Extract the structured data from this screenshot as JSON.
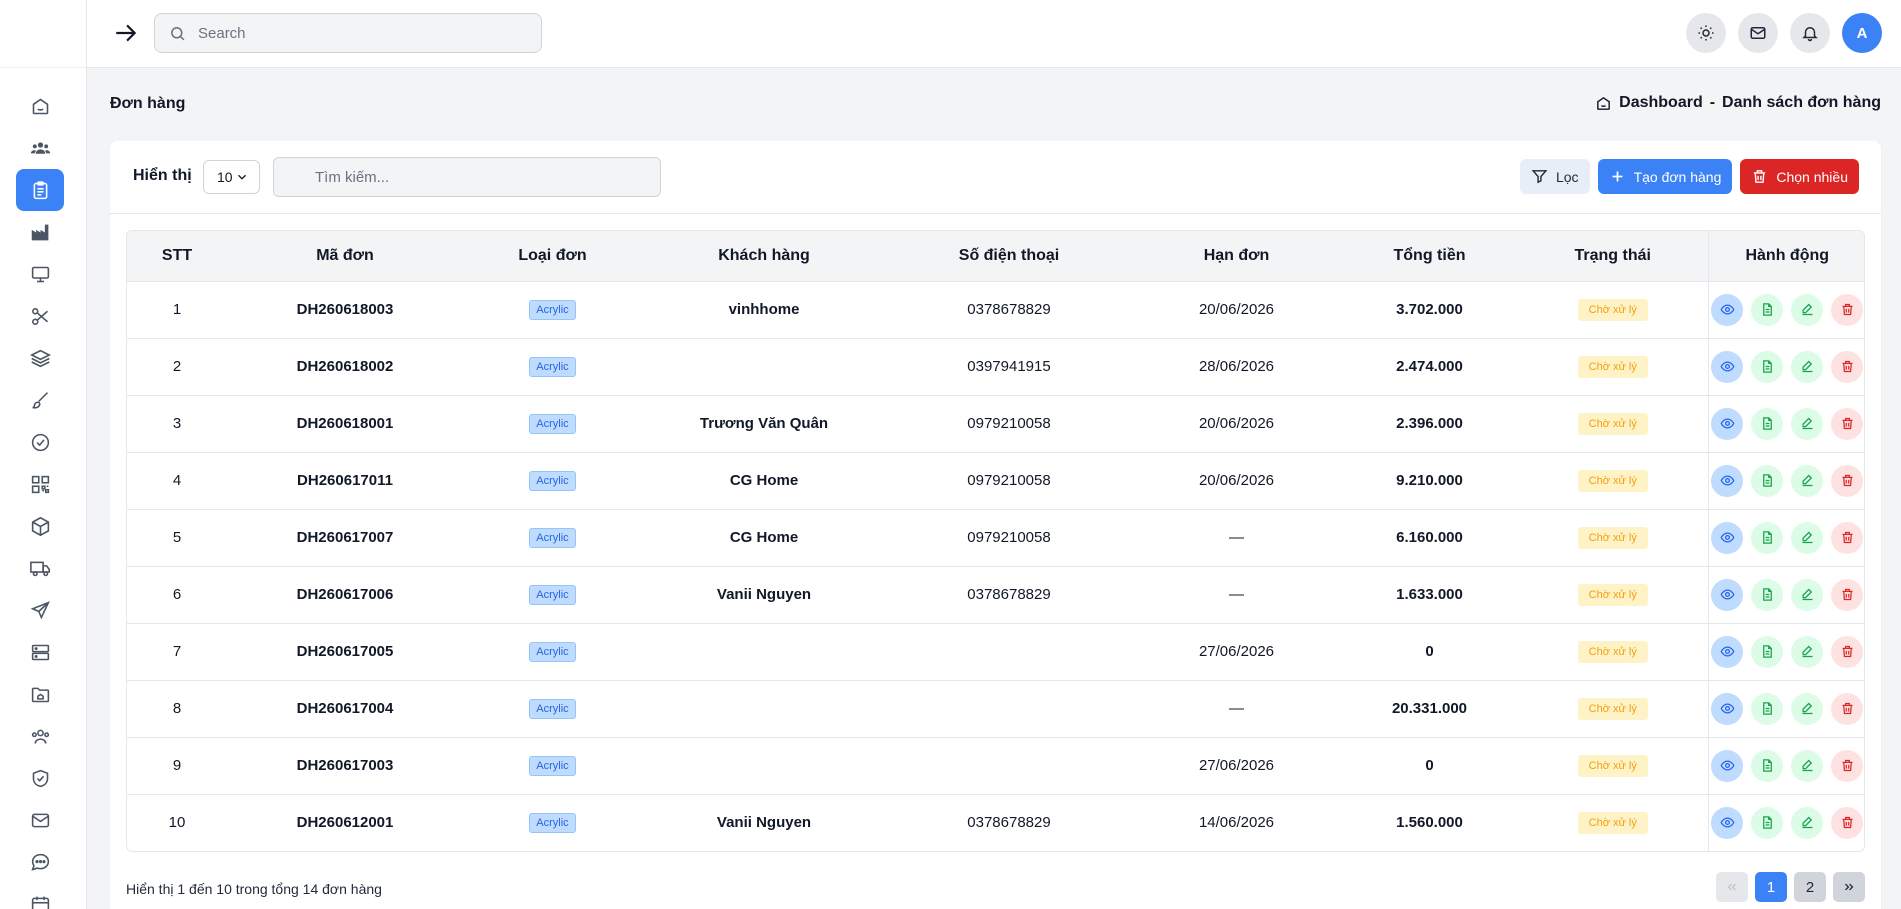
{
  "header": {
    "search_placeholder": "Search",
    "avatar_initial": "A"
  },
  "sidebar": {
    "items": [
      {
        "icon": "home-icon",
        "active": false
      },
      {
        "icon": "users-icon",
        "active": false
      },
      {
        "icon": "clipboard-icon",
        "active": true
      },
      {
        "icon": "factory-icon",
        "active": false
      },
      {
        "icon": "monitor-icon",
        "active": false
      },
      {
        "icon": "scissors-icon",
        "active": false
      },
      {
        "icon": "layers-icon",
        "active": false
      },
      {
        "icon": "brush-icon",
        "active": false
      },
      {
        "icon": "check-circle-icon",
        "active": false
      },
      {
        "icon": "qr-code-icon",
        "active": false
      },
      {
        "icon": "box-icon",
        "active": false
      },
      {
        "icon": "truck-icon",
        "active": false
      },
      {
        "icon": "send-icon",
        "active": false
      },
      {
        "icon": "server-icon",
        "active": false
      },
      {
        "icon": "folder-home-icon",
        "active": false
      },
      {
        "icon": "team-icon",
        "active": false
      },
      {
        "icon": "shield-check-icon",
        "active": false
      },
      {
        "icon": "mail-icon",
        "active": false
      },
      {
        "icon": "chat-icon",
        "active": false
      },
      {
        "icon": "calendar-icon",
        "active": false
      }
    ]
  },
  "page": {
    "title": "Đơn hàng",
    "breadcrumb_home": "Dashboard",
    "breadcrumb_sep": "-",
    "breadcrumb_current": "Danh sách đơn hàng"
  },
  "toolbar": {
    "show_label": "Hiển thị",
    "per_page": "10",
    "search_placeholder": "Tìm kiếm...",
    "filter_label": "Lọc",
    "create_label": "Tạo đơn hàng",
    "multi_label": "Chọn nhiều"
  },
  "table": {
    "columns": [
      "STT",
      "Mã đơn",
      "Loại đơn",
      "Khách hàng",
      "Số điện thoại",
      "Hạn đơn",
      "Tổng tiền",
      "Trạng thái",
      "Hành động"
    ],
    "rows": [
      {
        "stt": "1",
        "code": "DH260618003",
        "type": "Acrylic",
        "customer": "vinhhome",
        "phone": "0378678829",
        "due": "20/06/2026",
        "total": "3.702.000",
        "status": "Chờ xử lý"
      },
      {
        "stt": "2",
        "code": "DH260618002",
        "type": "Acrylic",
        "customer": "",
        "phone": "0397941915",
        "due": "28/06/2026",
        "total": "2.474.000",
        "status": "Chờ xử lý"
      },
      {
        "stt": "3",
        "code": "DH260618001",
        "type": "Acrylic",
        "customer": "Trương Văn Quân",
        "phone": "0979210058",
        "due": "20/06/2026",
        "total": "2.396.000",
        "status": "Chờ xử lý"
      },
      {
        "stt": "4",
        "code": "DH260617011",
        "type": "Acrylic",
        "customer": "CG Home",
        "phone": "0979210058",
        "due": "20/06/2026",
        "total": "9.210.000",
        "status": "Chờ xử lý"
      },
      {
        "stt": "5",
        "code": "DH260617007",
        "type": "Acrylic",
        "customer": "CG Home",
        "phone": "0979210058",
        "due": "—",
        "total": "6.160.000",
        "status": "Chờ xử lý"
      },
      {
        "stt": "6",
        "code": "DH260617006",
        "type": "Acrylic",
        "customer": "Vanii Nguyen",
        "phone": "0378678829",
        "due": "—",
        "total": "1.633.000",
        "status": "Chờ xử lý"
      },
      {
        "stt": "7",
        "code": "DH260617005",
        "type": "Acrylic",
        "customer": "",
        "phone": "",
        "due": "27/06/2026",
        "total": "0",
        "status": "Chờ xử lý"
      },
      {
        "stt": "8",
        "code": "DH260617004",
        "type": "Acrylic",
        "customer": "",
        "phone": "",
        "due": "—",
        "total": "20.331.000",
        "status": "Chờ xử lý"
      },
      {
        "stt": "9",
        "code": "DH260617003",
        "type": "Acrylic",
        "customer": "",
        "phone": "",
        "due": "27/06/2026",
        "total": "0",
        "status": "Chờ xử lý"
      },
      {
        "stt": "10",
        "code": "DH260612001",
        "type": "Acrylic",
        "customer": "Vanii Nguyen",
        "phone": "0378678829",
        "due": "14/06/2026",
        "total": "1.560.000",
        "status": "Chờ xử lý"
      }
    ]
  },
  "footer": {
    "summary": "Hiển thị 1 đến 10 trong tổng 14 đơn hàng",
    "pages": [
      "1",
      "2"
    ],
    "current_page": "1"
  },
  "colors": {
    "primary": "#3b82f6",
    "danger": "#dc2626",
    "success": "#16a34a",
    "warning": "#f59e0b"
  }
}
